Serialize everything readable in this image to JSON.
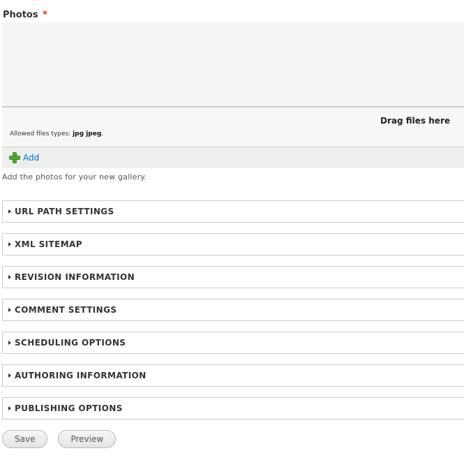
{
  "photos_field": {
    "label": "Photos",
    "required_marker": "*",
    "drag_text": "Drag files here",
    "allowed_prefix": "Allowed files types:",
    "allowed_types": "jpg jpeg",
    "allowed_suffix": ".",
    "add_label": "Add",
    "description": "Add the photos for your new gallery."
  },
  "fieldsets": [
    {
      "legend": "URL PATH SETTINGS"
    },
    {
      "legend": "XML SITEMAP"
    },
    {
      "legend": "REVISION INFORMATION"
    },
    {
      "legend": "COMMENT SETTINGS"
    },
    {
      "legend": "SCHEDULING OPTIONS"
    },
    {
      "legend": "AUTHORING INFORMATION"
    },
    {
      "legend": "PUBLISHING OPTIONS"
    }
  ],
  "actions": {
    "save_label": "Save",
    "preview_label": "Preview"
  },
  "colors": {
    "required": "#e32700",
    "link": "#0074bd",
    "add_icon": "#52a634"
  },
  "icons": {
    "add": "plus-icon",
    "fieldset_toggle": "triangle-right-icon"
  }
}
